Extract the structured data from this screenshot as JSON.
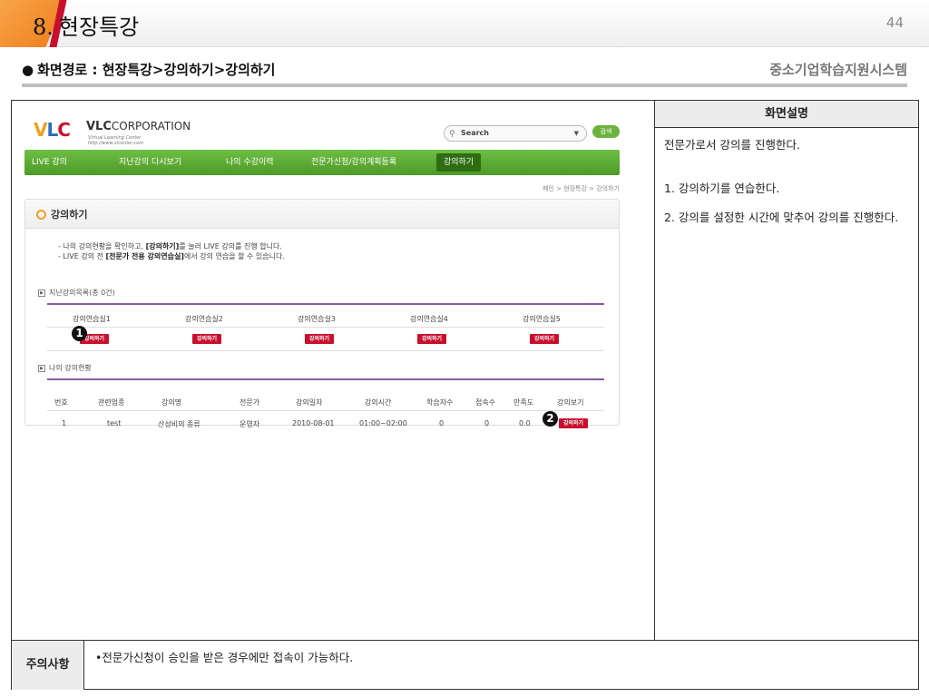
{
  "slide": {
    "number": "8.",
    "title": "현장특강",
    "page_number": "44",
    "screen_path": "화면경로 : 현장특강>강의하기>강의하기",
    "system_name": "중소기업학습지원시스템"
  },
  "site": {
    "logo": {
      "v": "V",
      "l": "L",
      "c": "C",
      "corp_bold": "VLC",
      "corp_rest": "CORPORATION",
      "sub1": "Virtual Learning Center",
      "sub2": "http://www.vlcenter.com"
    },
    "search": {
      "placeholder": "Search",
      "button": "검색"
    },
    "nav": [
      "LIVE 강의",
      "지난강의 다시보기",
      "나의 수강이력",
      "전문가신청/강의계획등록",
      "강의하기"
    ],
    "breadcrumb": "메인 > 현장특강 > 강의하기",
    "page_title": "강의하기",
    "info": {
      "line1_pre": "- 나의 강의현황을 확인하고, ",
      "line1_bold": "[강의하기]",
      "line1_post": "를 눌러 LIVE 강의를 진행 합니다.",
      "line2_pre": "- LIVE 강의 전 ",
      "line2_bold": "[전문가 전용 강의연습실]",
      "line2_post": "에서 강의 연습을 할 수 있습니다."
    },
    "past_list_label": "지난강의목록(총 0건)",
    "practice_rooms": [
      "강의연습실1",
      "강의연습실2",
      "강의연습실3",
      "강의연습실4",
      "강의연습실5"
    ],
    "lecture_button": "강의하기",
    "my_status_label": "나의 강의현황",
    "table": {
      "headers": [
        "번호",
        "관련업종",
        "강의명",
        "전문가",
        "강의일자",
        "강의시간",
        "학습자수",
        "접속수",
        "만족도",
        "강의보기"
      ],
      "row": [
        "1",
        "test",
        "산성비의 종류",
        "운영자",
        "2010-08-01",
        "01:00~02:00",
        "0",
        "0",
        "0.0"
      ]
    }
  },
  "markers": [
    "1",
    "2"
  ],
  "description": {
    "header": "화면설명",
    "lines": [
      "전문가로서 강의를 진행한다.",
      "1. 강의하기를 연습한다.",
      "2. 강의를 설정한 시간에 맞추어 강의를 진행한다."
    ]
  },
  "notes": {
    "label": "주의사항",
    "text": "•전문가신청이 승인을 받은 경우에만 접속이 가능하다."
  }
}
